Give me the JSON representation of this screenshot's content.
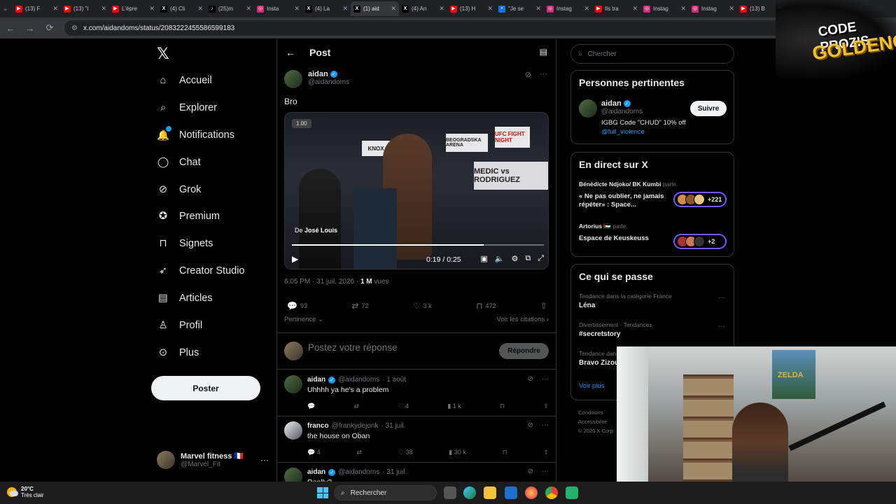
{
  "browser": {
    "tabs": [
      {
        "label": "(13) F",
        "color": "#ff0000",
        "glyph": "▶"
      },
      {
        "label": "(13) \"I",
        "color": "#ff0000",
        "glyph": "▶"
      },
      {
        "label": "L'épre",
        "color": "#ff0000",
        "glyph": "▶"
      },
      {
        "label": "(4) Cli",
        "color": "#000000",
        "glyph": "X"
      },
      {
        "label": "(25)m",
        "color": "#010101",
        "glyph": "♪"
      },
      {
        "label": "Insta",
        "color": "#d62976",
        "glyph": "◎"
      },
      {
        "label": "(4) La",
        "color": "#000000",
        "glyph": "X"
      },
      {
        "label": "(1) aid",
        "color": "#000000",
        "glyph": "X"
      },
      {
        "label": "(4) An",
        "color": "#000000",
        "glyph": "X"
      },
      {
        "label": "(13) H",
        "color": "#ff0000",
        "glyph": "▶"
      },
      {
        "label": "\"Je se",
        "color": "#1a73e8",
        "glyph": "•"
      },
      {
        "label": "Instag",
        "color": "#d62976",
        "glyph": "◎"
      },
      {
        "label": "Ils tra",
        "color": "#ff0000",
        "glyph": "▶"
      },
      {
        "label": "Instag",
        "color": "#d62976",
        "glyph": "◎"
      },
      {
        "label": "Instag",
        "color": "#d62976",
        "glyph": "◎"
      },
      {
        "label": "(13) B",
        "color": "#ff0000",
        "glyph": "▶"
      }
    ],
    "active_tab_index": 7,
    "url": "x.com/aidandoms/status/2083222455586599183"
  },
  "nav": {
    "items": [
      {
        "label": "Accueil",
        "icon": "home-icon"
      },
      {
        "label": "Explorer",
        "icon": "search-icon"
      },
      {
        "label": "Notifications",
        "icon": "bell-icon"
      },
      {
        "label": "Chat",
        "icon": "chat-icon"
      },
      {
        "label": "Grok",
        "icon": "grok-icon"
      },
      {
        "label": "Premium",
        "icon": "premium-icon"
      },
      {
        "label": "Signets",
        "icon": "bookmark-icon"
      },
      {
        "label": "Creator Studio",
        "icon": "rocket-icon"
      },
      {
        "label": "Articles",
        "icon": "article-icon"
      },
      {
        "label": "Profil",
        "icon": "person-icon"
      },
      {
        "label": "Plus",
        "icon": "more-icon"
      }
    ],
    "post_button": "Poster",
    "account": {
      "name": "Marvel fitness 🇫🇷",
      "handle": "@Marvel_Fit"
    }
  },
  "post": {
    "header_title": "Post",
    "author_name": "aidan",
    "author_handle": "@aidandoms",
    "text": "Bro",
    "video": {
      "speed": "1.00",
      "from_label": "De",
      "from_name": "José Louis",
      "time": "0:19 / 0:25",
      "progress": 0.76,
      "banner_texts": [
        "MEDIC vs RODRIGUEZ",
        "UFC FIGHT NIGHT",
        "KNOX",
        "BEOGRADSKA ARENA"
      ]
    },
    "time": "6:05 PM · 31 juil. 2026 ·",
    "views_count": "1 M",
    "views_label": "vues",
    "stats": {
      "replies": "93",
      "reposts": "72",
      "likes": "3 k",
      "bookmarks": "472"
    },
    "sort_label": "Pertinence",
    "quotes_label": "Voir les citations",
    "reply_placeholder": "Postez votre réponse",
    "reply_button": "Répondre"
  },
  "replies": [
    {
      "name": "aidan",
      "handle": "@aidandoms",
      "date": "· 1 août",
      "text": "Uhhhh ya he's a problem",
      "replies": "",
      "reposts": "",
      "likes": "4",
      "views": "1 k",
      "verified": true
    },
    {
      "name": "franco",
      "handle": "@frankydejonk",
      "date": "· 31 juil.",
      "text": "the house on Oban",
      "replies": "4",
      "reposts": "",
      "likes": "38",
      "views": "30 k",
      "verified": false
    },
    {
      "name": "aidan",
      "handle": "@aidandoms",
      "date": "· 31 juil.",
      "text": "Really?",
      "replies": "",
      "reposts": "",
      "likes": "",
      "views": "",
      "verified": true
    }
  ],
  "sidebar": {
    "search_placeholder": "Chercher",
    "relevant": {
      "title": "Personnes pertinentes",
      "name": "aidan",
      "handle": "@aidandoms",
      "bio": "IGBG Code \"CHUD\" 10% off",
      "bio_link": "@full_violence",
      "follow": "Suivre"
    },
    "live": {
      "title": "En direct sur X",
      "items": [
        {
          "host": "Bénédicte Ndjoko/ BK Kumbi",
          "suffix": "parle.",
          "title": "« Ne pas oublier, ne jamais répéter» : Space...",
          "count": "+221"
        },
        {
          "host": "Artorius 🇵🇸",
          "suffix": "parle.",
          "title": "Espace de Keuskeuss",
          "count": "+2"
        }
      ]
    },
    "trends": {
      "title": "Ce qui se passe",
      "items": [
        {
          "context": "Tendance dans la catégorie France",
          "name": "Léna"
        },
        {
          "context": "Divertissement · Tendances",
          "name": "#secretstory"
        },
        {
          "context": "Tendance dans",
          "name": "Bravo Zizou"
        }
      ],
      "more": "Voir plus"
    },
    "footer": [
      "Conditions",
      "Accessibilité",
      "© 2026 X Corp."
    ]
  },
  "overlay": {
    "logo_line1": "CODE PROZIS",
    "logo_line2": "GOLDENG",
    "poster_text": "ZELDA"
  },
  "taskbar": {
    "temp": "20°C",
    "weather": "Très clair",
    "search": "Rechercher"
  }
}
